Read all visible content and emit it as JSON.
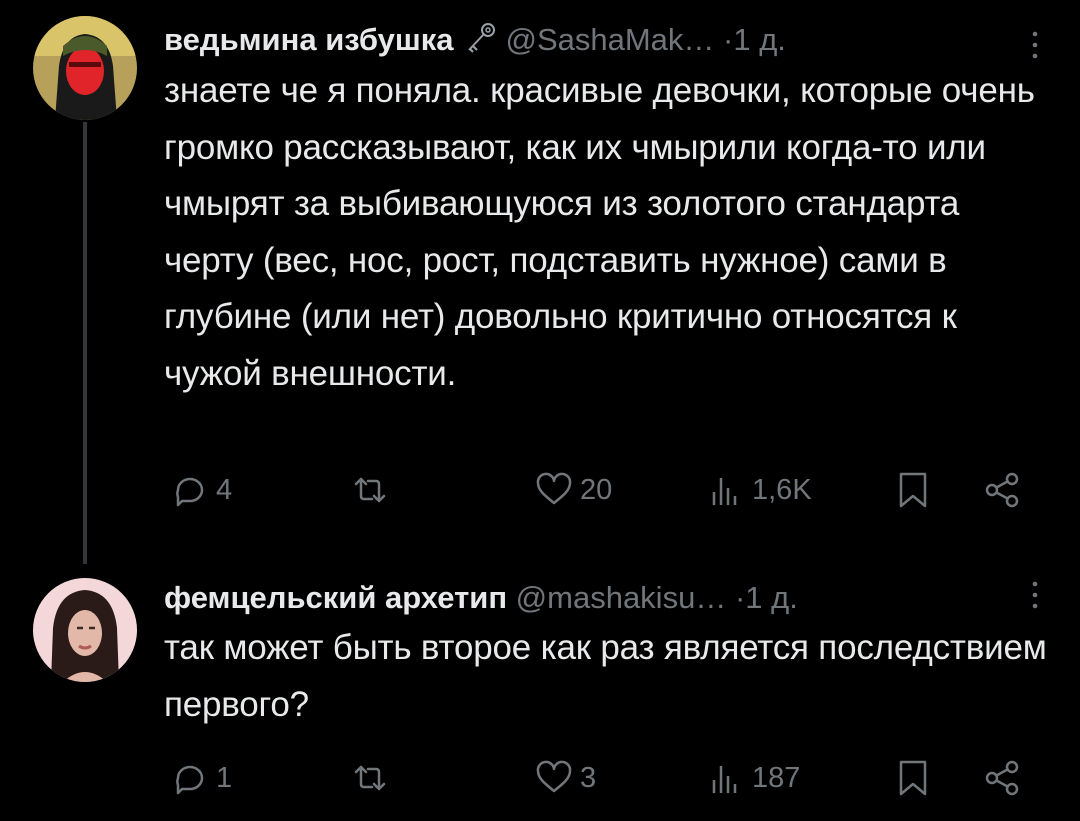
{
  "tweets": [
    {
      "author": "ведьмина избушка",
      "badge_icon": "key-icon",
      "handle": "@SashaMak…",
      "separator": "·",
      "time": "1 д.",
      "text": "знаете че я поняла. красивые девочки, которые очень громко рассказывают, как их чмырили когда-то или чмырят за выбивающуюся из золотого стандарта черту (вес, нос, рост, подставить нужное) сами в глубине (или нет) довольно критично относятся к чужой внешности.",
      "replies": "4",
      "retweets": "",
      "likes": "20",
      "views": "1,6K"
    },
    {
      "author": "фемцельский архетип",
      "handle": "@mashakisu…",
      "separator": "·",
      "time": "1 д.",
      "text": "так может быть второе как раз является последствием первого?",
      "replies": "1",
      "retweets": "",
      "likes": "3",
      "views": "187"
    }
  ],
  "colors": {
    "background": "#000000",
    "text": "#e7e9ea",
    "muted": "#71767b",
    "thread_line": "#333639"
  }
}
